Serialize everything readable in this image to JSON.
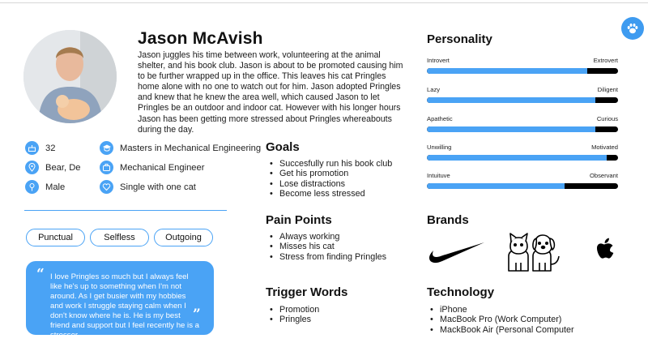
{
  "persona": {
    "name": "Jason McAvish",
    "bio": "Jason juggles his time between work, volunteering at the animal shelter, and his book club. Jason is about to be promoted causing him to be further wrapped up in the office. This leaves his cat Pringles home alone with no one to watch out for him. Jason adopted Pringles and knew that he knew the area well, which caused Jason to let Pringles be an outdoor and indoor cat. However with his longer hours Jason has been getting more stressed about Pringles whereabouts during the day."
  },
  "facts": [
    {
      "icon": "cake-icon",
      "text": "32"
    },
    {
      "icon": "location-pin-icon",
      "text": "Bear, De"
    },
    {
      "icon": "male-icon",
      "text": "Male"
    },
    {
      "icon": "graduation-cap-icon",
      "text": "Masters in Mechanical Engineering"
    },
    {
      "icon": "briefcase-icon",
      "text": "Mechanical Engineer"
    },
    {
      "icon": "heart-icon",
      "text": "Single with one cat"
    }
  ],
  "traits": [
    "Punctual",
    "Selfless",
    "Outgoing"
  ],
  "quote": "I love Pringles so much but I always feel like he's up to something when I'm not around. As I get busier with my hobbies and work I struggle staying calm when I don't know where he is. He is my best friend and support but I feel recently he is a stressor.",
  "goals": {
    "title": "Goals",
    "items": [
      "Succesfully run his book club",
      "Get his promotion",
      "Lose distractions",
      "Become less stressed"
    ]
  },
  "pain_points": {
    "title": "Pain Points",
    "items": [
      "Always working",
      "Misses his cat",
      "Stress from finding Pringles"
    ]
  },
  "trigger_words": {
    "title": "Trigger Words",
    "items": [
      "Promotion",
      "Pringles"
    ]
  },
  "personality": {
    "title": "Personality",
    "scales": [
      {
        "left": "Introvert",
        "right": "Extrovert",
        "value": 0.84
      },
      {
        "left": "Lazy",
        "right": "Diligent",
        "value": 0.88
      },
      {
        "left": "Apathetic",
        "right": "Curious",
        "value": 0.88
      },
      {
        "left": "Unwilling",
        "right": "Motivated",
        "value": 0.94
      },
      {
        "left": "Intuituve",
        "right": "Observant",
        "value": 0.72
      }
    ]
  },
  "brands": {
    "title": "Brands",
    "logos": [
      "nike-swoosh-logo",
      "cat-and-dog-logo",
      "apple-logo"
    ]
  },
  "technology": {
    "title": "Technology",
    "items": [
      "iPhone",
      "MacBook Pro (Work Computer)",
      "MackBook Air (Personal Computer"
    ]
  },
  "colors": {
    "accent": "#4aa3f5",
    "bar_track": "#000000"
  }
}
